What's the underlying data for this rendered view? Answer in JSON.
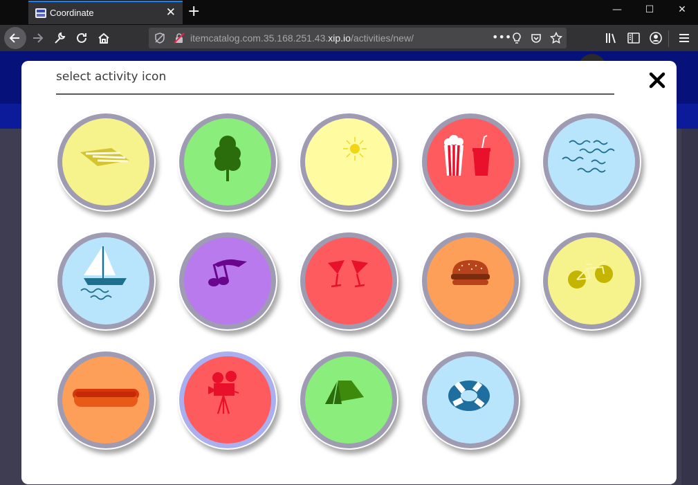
{
  "browser": {
    "tab_title": "Coordinate",
    "url_prefix": "itemcatalog.com.35.168.251.43.",
    "url_host": "xip.io",
    "url_path": "/activities/new/"
  },
  "modal": {
    "title": "select activity icon",
    "close_label": "close"
  },
  "colors": {
    "ring": "#9e9bb2",
    "ring_selected": "#a9afef",
    "yellow": "#f6f28c",
    "green": "#8aed7c",
    "red": "#fe5b5f",
    "blue": "#b9e5fc",
    "purple": "#b97aee",
    "orange": "#fd9f59",
    "pale_yellow": "#fefba0"
  },
  "icons": [
    {
      "name": "beach-towel-icon",
      "bg": "yellow"
    },
    {
      "name": "tree-icon",
      "bg": "green"
    },
    {
      "name": "sun-icon",
      "bg": "pale_yellow"
    },
    {
      "name": "popcorn-drink-icon",
      "bg": "red"
    },
    {
      "name": "waves-icon",
      "bg": "blue"
    },
    {
      "name": "sailboat-icon",
      "bg": "blue"
    },
    {
      "name": "music-note-icon",
      "bg": "purple"
    },
    {
      "name": "cocktail-glasses-icon",
      "bg": "red"
    },
    {
      "name": "burger-icon",
      "bg": "orange"
    },
    {
      "name": "bicycle-icon",
      "bg": "yellow"
    },
    {
      "name": "hotdog-icon",
      "bg": "orange"
    },
    {
      "name": "movie-camera-icon",
      "bg": "red",
      "selected": true
    },
    {
      "name": "tent-icon",
      "bg": "green"
    },
    {
      "name": "life-ring-icon",
      "bg": "blue"
    }
  ]
}
